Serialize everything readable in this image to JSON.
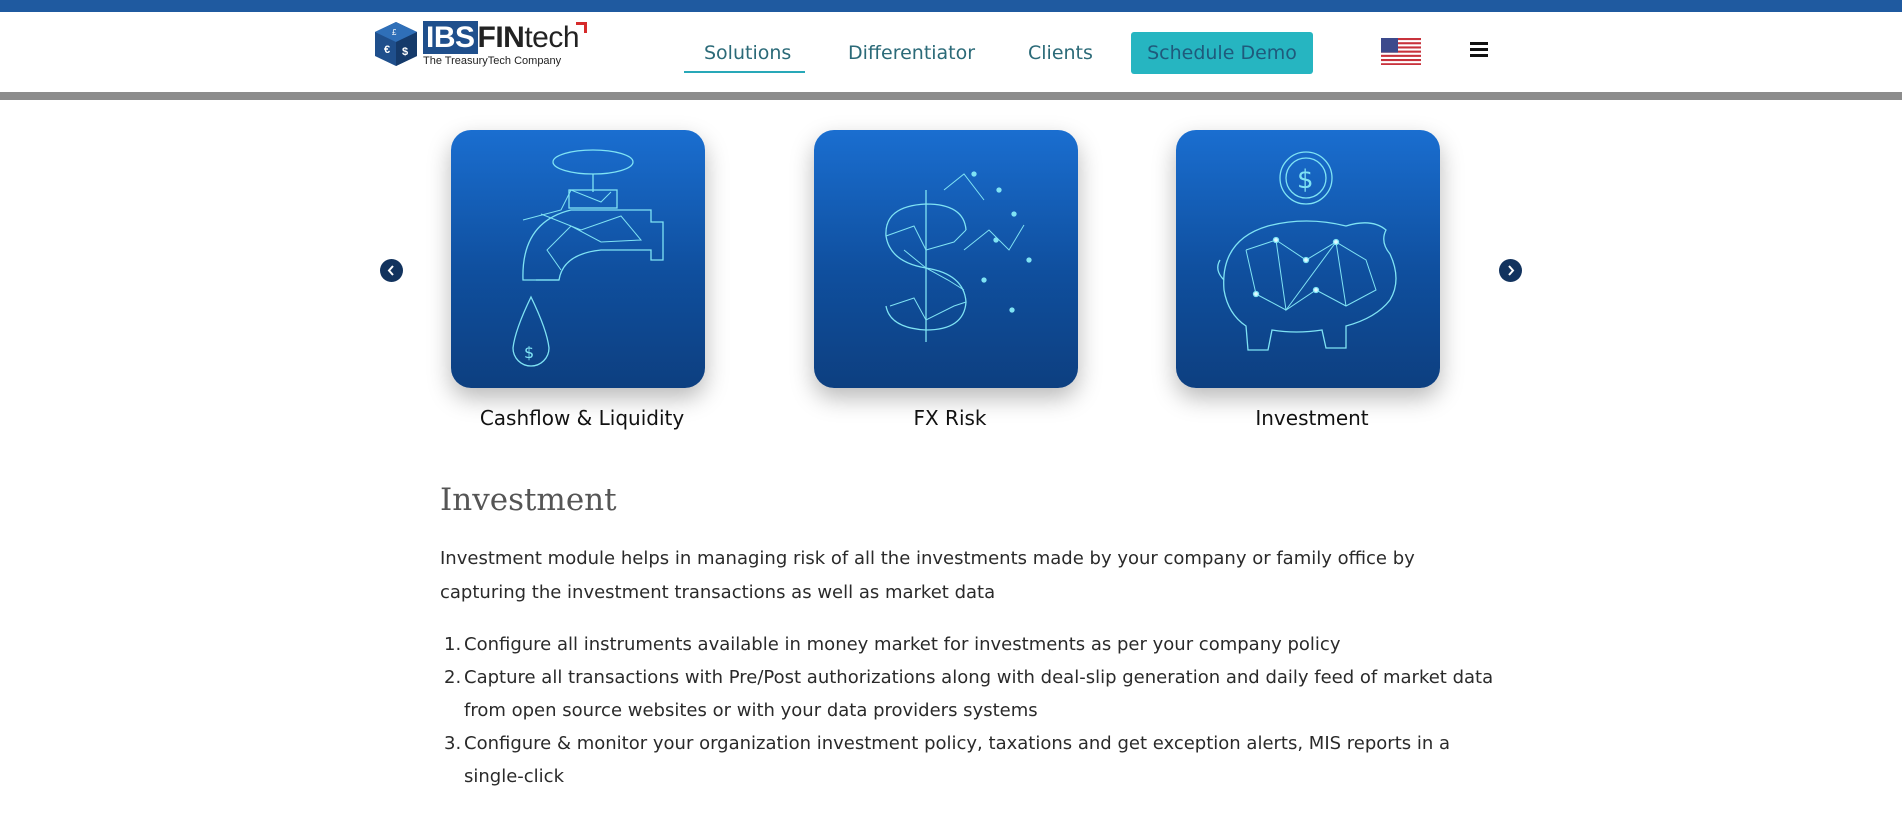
{
  "brand": {
    "logo_prefix": "IBS",
    "logo_bold": "FIN",
    "logo_suffix": "tech",
    "tagline": "The TreasuryTech Company"
  },
  "nav": {
    "items": [
      {
        "label": "Solutions",
        "active": true
      },
      {
        "label": "Differentiator",
        "active": false
      },
      {
        "label": "Clients",
        "active": false
      }
    ],
    "cta_label": "Schedule Demo",
    "flag_icon": "us-flag-icon",
    "menu_icon": "hamburger-menu-icon"
  },
  "carousel": {
    "prev_icon": "chevron-left-icon",
    "next_icon": "chevron-right-icon",
    "cards": [
      {
        "label": "Cashflow & Liquidity",
        "icon": "faucet-icon"
      },
      {
        "label": "FX Risk",
        "icon": "dollar-sign-icon"
      },
      {
        "label": "Investment",
        "icon": "piggy-bank-icon"
      }
    ]
  },
  "section": {
    "title": "Investment",
    "intro": "Investment module helps in managing risk of all the investments made by your company or family office by capturing the investment transactions as well as market data",
    "points": [
      {
        "num": "1.",
        "text": "Configure all instruments available in money market for investments as per your company policy"
      },
      {
        "num": "2.",
        "text": "Capture all transactions with Pre/Post authorizations along with deal-slip generation and daily feed of market data from open source websites or with your data providers systems"
      },
      {
        "num": "3.",
        "text": "Configure & monitor your organization investment policy, taxations and get exception alerts, MIS reports in a single-click"
      }
    ]
  },
  "colors": {
    "top_strip": "#1f5aa0",
    "nav_text": "#2b6a78",
    "cta_bg": "#26b5c1",
    "card_blue": "#1a6ed0",
    "arrow_bg": "#12335e"
  }
}
